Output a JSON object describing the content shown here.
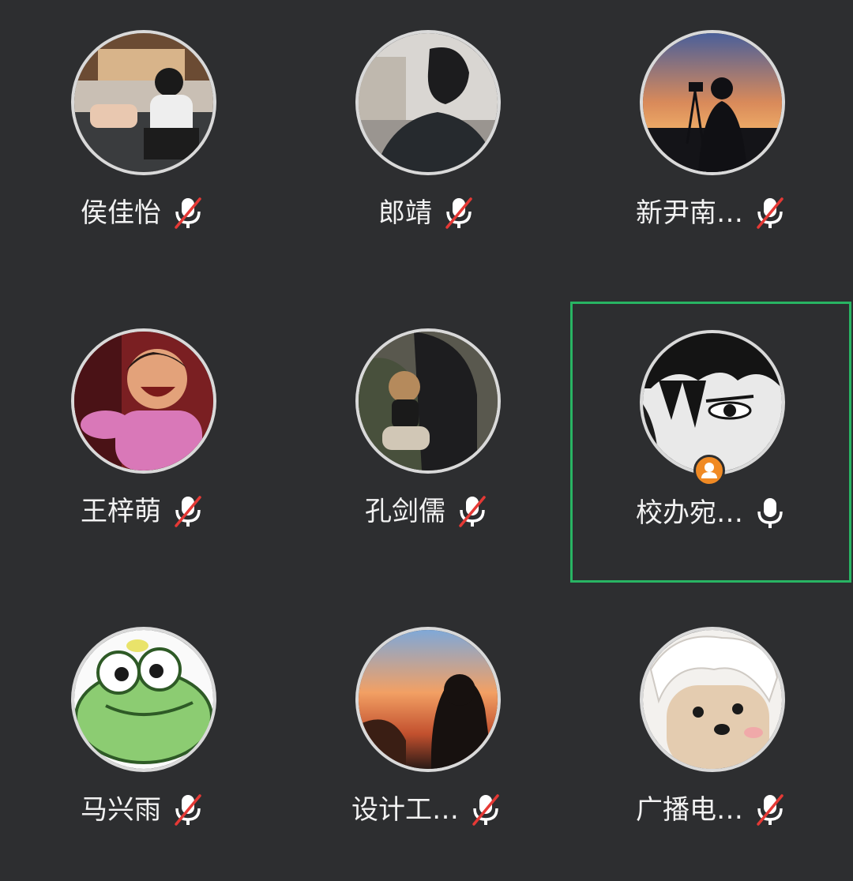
{
  "participants": [
    {
      "name": "侯佳怡",
      "mic": "muted",
      "avatar_icon": "girl-sitting-photo"
    },
    {
      "name": "郎靖",
      "mic": "muted",
      "avatar_icon": "man-dark-photo"
    },
    {
      "name": "新尹南…",
      "mic": "muted",
      "avatar_icon": "sunset-silhouette-photo"
    },
    {
      "name": "王梓萌",
      "mic": "muted",
      "avatar_icon": "cartoon-girl-avatar"
    },
    {
      "name": "孔剑儒",
      "mic": "muted",
      "avatar_icon": "person-with-toy-photo"
    },
    {
      "name": "校办宛…",
      "mic": "on",
      "is_host": true,
      "active_speaker": true,
      "avatar_icon": "anime-boy-avatar"
    },
    {
      "name": "马兴雨",
      "mic": "muted",
      "avatar_icon": "green-frog-avatar"
    },
    {
      "name": "设计工…",
      "mic": "muted",
      "avatar_icon": "sunset-girl-photo"
    },
    {
      "name": "广播电…",
      "mic": "muted",
      "avatar_icon": "cartoon-character-avatar"
    }
  ],
  "colors": {
    "background": "#2d2e30",
    "active_border": "#28b463",
    "host_badge": "#f08a24",
    "mute_slash": "#e53935"
  }
}
